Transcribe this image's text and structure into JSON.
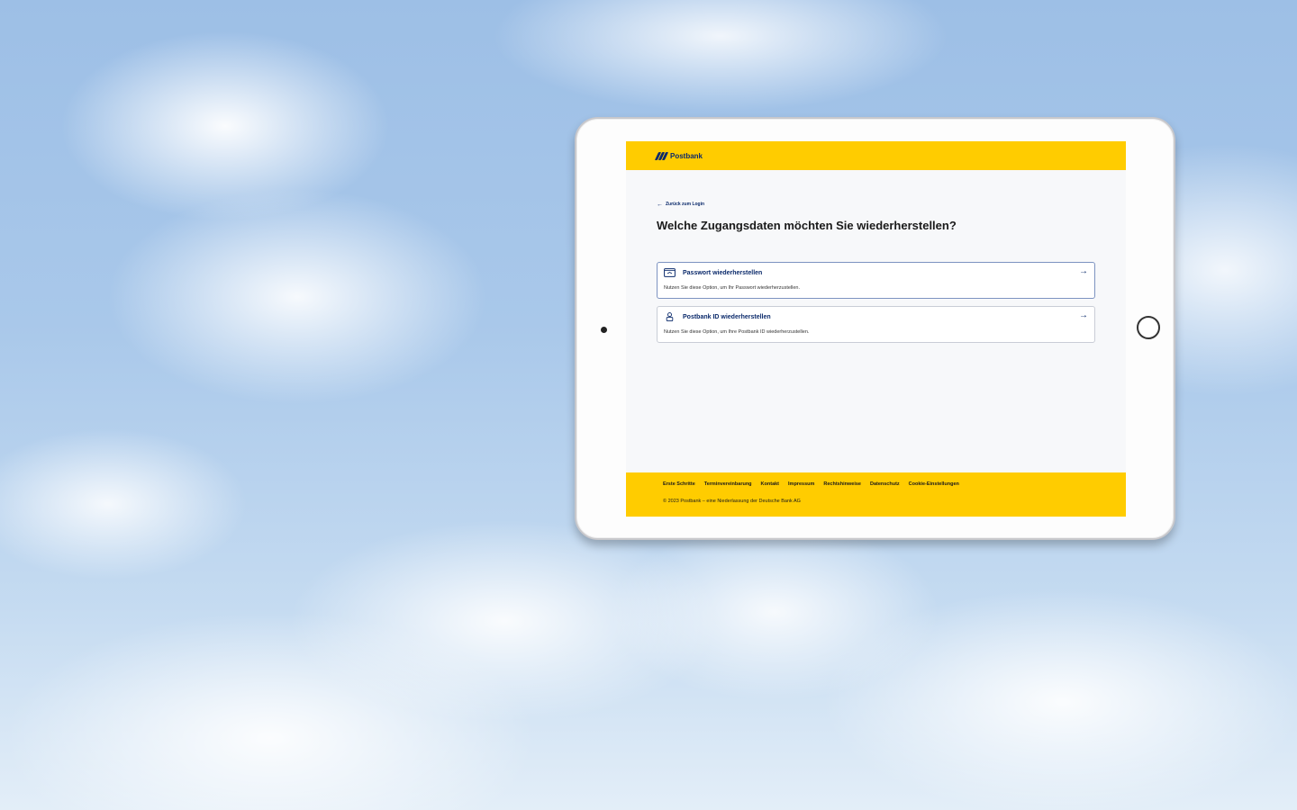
{
  "brand": {
    "name": "Postbank",
    "primary_color": "#ffcc00",
    "accent_color": "#0b2a6b"
  },
  "nav": {
    "back_label": "Zurück zum Login"
  },
  "main": {
    "title": "Welche Zugangsdaten möchten Sie wiederherstellen?",
    "options": [
      {
        "icon": "password-card-icon",
        "title": "Passwort wiederherstellen",
        "description": "Nutzen Sie diese Option, um Ihr Passwort wiederherzustellen."
      },
      {
        "icon": "user-icon",
        "title": "Postbank ID wiederherstellen",
        "description": "Nutzen Sie diese Option, um Ihre Postbank ID wiederherzustellen."
      }
    ]
  },
  "footer": {
    "links": [
      "Erste Schritte",
      "Terminvereinbarung",
      "Kontakt",
      "Impressum",
      "Rechtshinweise",
      "Datenschutz",
      "Cookie-Einstellungen"
    ],
    "copyright": "© 2023 Postbank – eine Niederlassung der Deutsche Bank AG"
  }
}
